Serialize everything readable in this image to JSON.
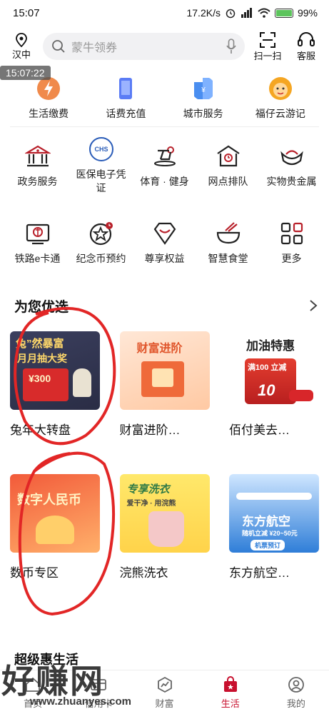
{
  "status": {
    "time": "15:07",
    "speed": "17.2K/s",
    "battery": "99%"
  },
  "header": {
    "location": "汉中",
    "search_placeholder": "蒙牛领券",
    "scan_label": "扫一扫",
    "service_label": "客服"
  },
  "overlay_time": "15:07:22",
  "top_services": [
    {
      "label": "生活缴费",
      "icon": "utility-icon"
    },
    {
      "label": "话费充值",
      "icon": "phone-icon"
    },
    {
      "label": "城市服务",
      "icon": "city-icon"
    },
    {
      "label": "福仔云游记",
      "icon": "mascot-icon"
    }
  ],
  "grid_row1": [
    {
      "label": "政务服务",
      "icon": "government-icon"
    },
    {
      "label": "医保电子凭证",
      "icon": "chs-icon",
      "badge": "CHS"
    },
    {
      "label": "体育 · 健身",
      "icon": "bike-icon"
    },
    {
      "label": "网点排队",
      "icon": "branch-icon"
    },
    {
      "label": "实物贵金属",
      "icon": "gold-icon"
    }
  ],
  "grid_row2": [
    {
      "label": "铁路e卡通",
      "icon": "rail-icon"
    },
    {
      "label": "纪念币预约",
      "icon": "coin-icon"
    },
    {
      "label": "尊享权益",
      "icon": "gem-icon"
    },
    {
      "label": "智慧食堂",
      "icon": "bowl-icon"
    },
    {
      "label": "更多",
      "icon": "more-icon"
    }
  ],
  "section": {
    "title": "为您优选"
  },
  "tiles_row1": [
    {
      "label": "兔年大转盘",
      "img_title": "兔”然暴富",
      "img_sub": "月月抽大奖",
      "img_value": "¥300"
    },
    {
      "label": "财富进阶…",
      "img_title": "财富进阶"
    },
    {
      "label": "佰付美去…",
      "img_title": "加油特惠",
      "img_sub": "满100 立减",
      "img_value": "10"
    }
  ],
  "tiles_row2": [
    {
      "label": "数币专区",
      "img_title": "数字人民币"
    },
    {
      "label": "浣熊洗衣",
      "img_title": "专享洗衣",
      "img_sub": "爱干净 · 用浣熊"
    },
    {
      "label": "东方航空…",
      "img_title": "东方航空",
      "img_sub": "随机立减 ¥20~50元",
      "img_btn": "机票预订"
    }
  ],
  "next_section": "超级惠生活",
  "tabbar": [
    {
      "label": "首页",
      "active": false
    },
    {
      "label": "信用卡",
      "active": false
    },
    {
      "label": "财富",
      "active": false
    },
    {
      "label": "生活",
      "active": true
    },
    {
      "label": "我的",
      "active": false
    }
  ],
  "watermark": {
    "big": "好赚网",
    "small": "www.zhuanyes.com"
  },
  "colors": {
    "brand_red": "#c8102e",
    "icon_red": "#b8202a"
  }
}
